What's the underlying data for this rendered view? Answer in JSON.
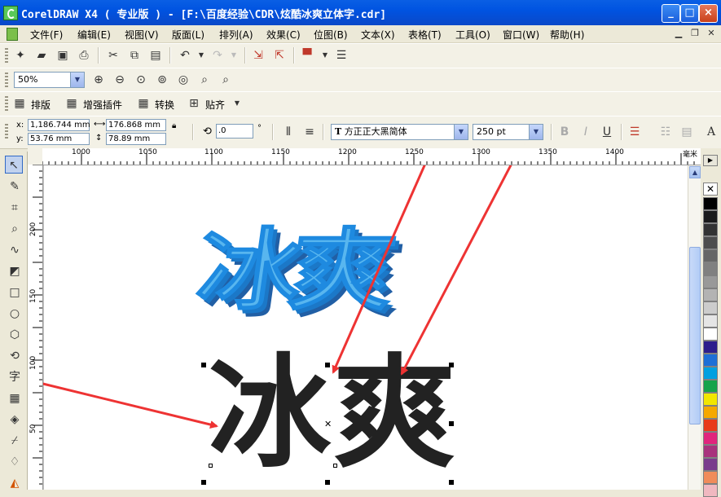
{
  "window": {
    "title": "CorelDRAW X4 ( 专业版 ) - [F:\\百度经验\\CDR\\炫酷冰爽立体字.cdr]",
    "minimize": "_",
    "maximize": "□",
    "close": "×"
  },
  "menu": [
    "文件(F)",
    "编辑(E)",
    "视图(V)",
    "版面(L)",
    "排列(A)",
    "效果(C)",
    "位图(B)",
    "文本(X)",
    "表格(T)",
    "工具(O)",
    "窗口(W)",
    "帮助(H)"
  ],
  "zoom": {
    "value": "50%"
  },
  "plugins": [
    {
      "label": "排版"
    },
    {
      "label": "增强插件"
    },
    {
      "label": "转换"
    },
    {
      "label": "贴齐"
    }
  ],
  "properties": {
    "x_label": "x:",
    "x": "1,186.744 mm",
    "y_label": "y:",
    "y": "53.76 mm",
    "width": "176.868 mm",
    "height": "78.89 mm",
    "angle": ".0",
    "degree": "°",
    "font": "方正正大黑简体",
    "font_size": "250 pt"
  },
  "rulers": {
    "h_labels": [
      "1000",
      "1050",
      "1100",
      "1150",
      "1200",
      "1250",
      "1300",
      "1350",
      "1400"
    ],
    "v_labels": [
      "200",
      "150",
      "100",
      "50"
    ],
    "unit": "毫米"
  },
  "canvas": {
    "outline_text": "冰爽",
    "black_text_1": "冰",
    "black_text_2": "爽"
  },
  "palette_colors": [
    "#000000",
    "#1a1a1a",
    "#333333",
    "#4d4d4d",
    "#666666",
    "#808080",
    "#999999",
    "#b3b3b3",
    "#cccccc",
    "#e5e5e5",
    "#ffffff",
    "#2d1e8c",
    "#1e6fd6",
    "#00a0e0",
    "#16a34a",
    "#f2e600",
    "#f5a800",
    "#e83a18",
    "#e0257c",
    "#a8327c",
    "#7a3c8c",
    "#f08c5a",
    "#f0b8c0"
  ],
  "colors": {
    "blue_text": "#1e8ae0",
    "arrow": "#ee3333"
  }
}
